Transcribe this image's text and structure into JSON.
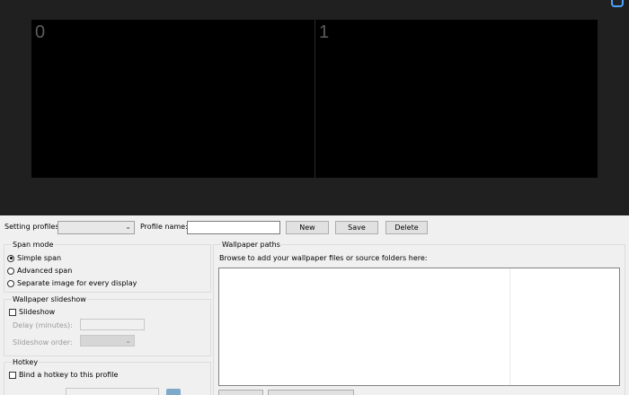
{
  "preview": {
    "monitors": [
      {
        "label": "0"
      },
      {
        "label": "1"
      }
    ],
    "corner_icon": "window-restore-icon"
  },
  "toolbar": {
    "setting_profiles_label": "Setting profiles:",
    "setting_profiles_value": "",
    "profile_name_label": "Profile name:",
    "profile_name_value": "",
    "new_label": "New",
    "save_label": "Save",
    "delete_label": "Delete"
  },
  "span_mode": {
    "title": "Span mode",
    "options": [
      {
        "label": "Simple span",
        "selected": true
      },
      {
        "label": "Advanced span",
        "selected": false
      },
      {
        "label": "Separate image for every display",
        "selected": false
      }
    ]
  },
  "slideshow": {
    "title": "Wallpaper slideshow",
    "checkbox_label": "Slideshow",
    "checked": false,
    "delay_label": "Delay (minutes):",
    "delay_value": "",
    "order_label": "Slideshow order:",
    "order_value": ""
  },
  "hotkey": {
    "title": "Hotkey",
    "checkbox_label": "Bind a hotkey to this profile",
    "checked": false
  },
  "wallpaper_paths": {
    "title": "Wallpaper paths",
    "instructions": "Browse to add your wallpaper files or source folders here:"
  }
}
